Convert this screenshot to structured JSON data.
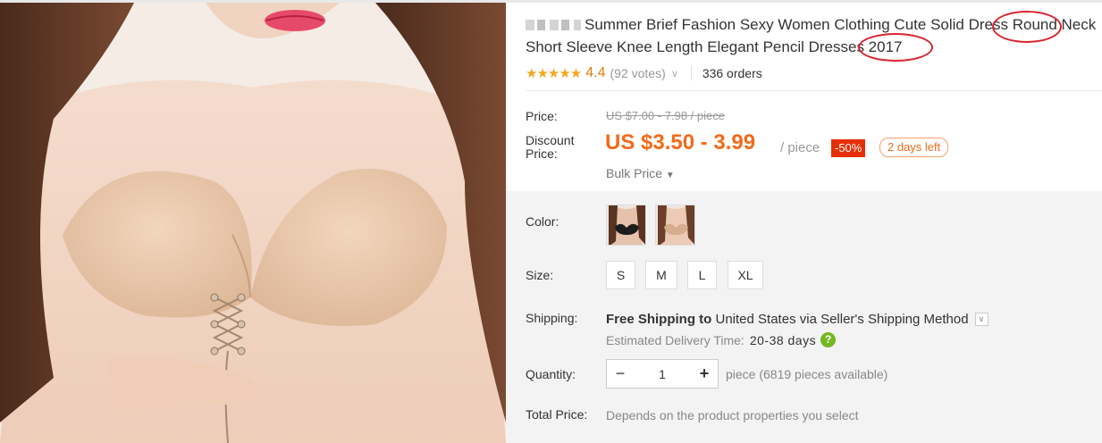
{
  "product": {
    "title": "Summer Brief Fashion Sexy Women Clothing Cute Solid Dress Round Neck Short Sleeve Knee Length Elegant Pencil Dresses 2017",
    "image_alt": "product photo"
  },
  "rating": {
    "stars": "★★★★★",
    "score": "4.4",
    "votes": "(92 votes)",
    "orders": "336 orders"
  },
  "price": {
    "price_label": "Price:",
    "original": "US $7.00 - 7.98 / piece",
    "discount_label_1": "Discount",
    "discount_label_2": "Price:",
    "discounted": "US $3.50 - 3.99",
    "unit": "/ piece",
    "discount_badge": "-50%",
    "days_left": "2 days left",
    "bulk": "Bulk Price"
  },
  "options": {
    "color_label": "Color:",
    "size_label": "Size:",
    "sizes": [
      "S",
      "M",
      "L",
      "XL"
    ],
    "shipping_label": "Shipping:",
    "shipping_bold": "Free Shipping to",
    "shipping_dest": " United States via Seller's Shipping Method",
    "est_label": "Estimated Delivery Time:",
    "est_value": "20-38 days",
    "help_icon": "?",
    "quantity_label": "Quantity:",
    "qty_minus": "−",
    "qty_value": "1",
    "qty_plus": "+",
    "pieces_available": "piece (6819 pieces available)",
    "total_label": "Total Price:",
    "total_note": "Depends on the product properties you select"
  },
  "colors": {
    "accent_orange": "#f16a1a",
    "badge_red": "#e62e04",
    "star_gold": "#f5a623",
    "annotation_red": "#d9232e",
    "help_green": "#74b820"
  }
}
